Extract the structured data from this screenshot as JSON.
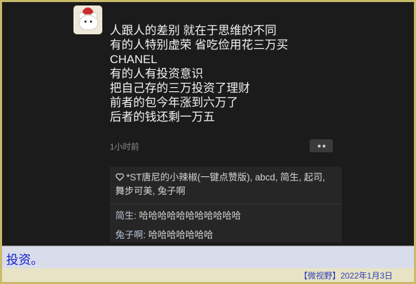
{
  "post": {
    "lines": [
      "人跟人的差别 就在于思维的不同",
      "有的人特别虚荣 省吃俭用花三万买",
      "CHANEL",
      "有的人有投资意识",
      "把自己存的三万投资了理财",
      "前者的包今年涨到六万了",
      "后者的钱还剩一万五"
    ],
    "timestamp": "1小时前"
  },
  "likes": {
    "icon": "heart-outline-icon",
    "text": "*ST唐尼的小辣椒(一键点赞版), abcd, 简生, 起司, 舞步可美, 兔子啊"
  },
  "comments": [
    {
      "author": "简生",
      "separator": ": ",
      "text": "哈哈哈哈哈哈哈哈哈哈哈"
    },
    {
      "author": "兔子啊",
      "separator": ": ",
      "text": "哈哈哈哈哈哈哈"
    }
  ],
  "caption": "投资。",
  "source": "【微视野】2022年1月3日"
}
